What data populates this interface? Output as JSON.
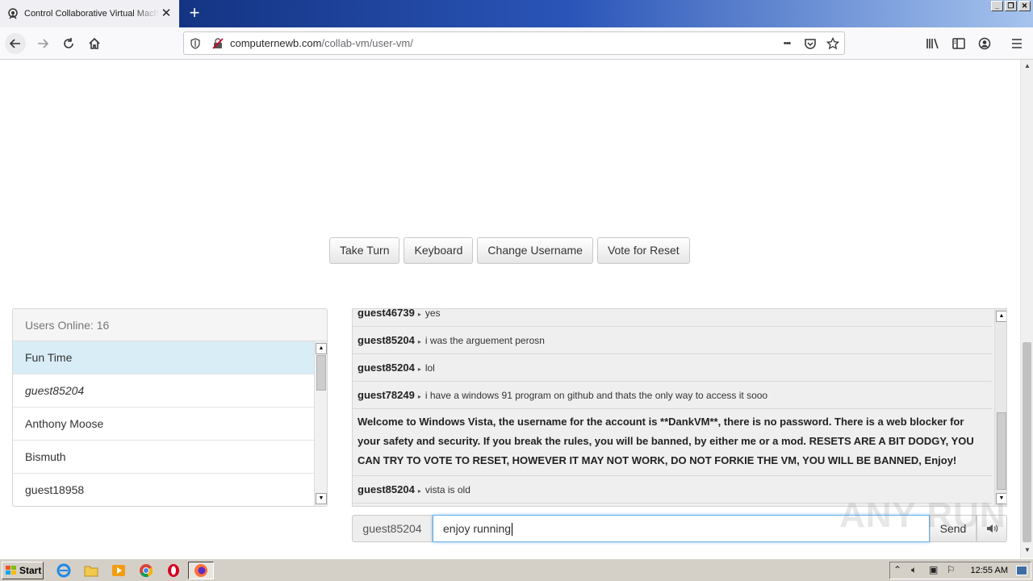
{
  "browser": {
    "tab_title": "Control Collaborative Virtual Machines",
    "url_domain": "computernewb.com",
    "url_path": "/collab-vm/user-vm/",
    "url_more": "•••"
  },
  "actions": [
    "Take Turn",
    "Keyboard",
    "Change Username",
    "Vote for Reset"
  ],
  "users": {
    "header": "Users Online: 16",
    "list": [
      {
        "name": "Fun Time"
      },
      {
        "name": "guest85204"
      },
      {
        "name": "Anthony Moose"
      },
      {
        "name": "Bismuth"
      },
      {
        "name": "guest18958"
      }
    ]
  },
  "chat": {
    "messages": [
      {
        "user": "guest46739",
        "text": "yes"
      },
      {
        "user": "guest85204",
        "text": "i was the arguement perosn"
      },
      {
        "user": "guest85204",
        "text": "lol"
      },
      {
        "user": "guest78249",
        "text": "i have a windows 91 program on github and thats the only way to access it sooo"
      },
      {
        "notice": "Welcome to Windows Vista, the username for the account is **DankVM**, there is no password. There is a web blocker for your safety and security. If you break the rules, you will be banned, by either me or a mod. RESETS ARE A BIT DODGY, YOU CAN TRY TO VOTE TO RESET, HOWEVER IT MAY NOT WORK, DO NOT FORKIE THE VM, YOU WILL BE BANNED, Enjoy!"
      },
      {
        "user": "guest85204",
        "text": "vista is old"
      }
    ],
    "input_username": "guest85204",
    "input_value": "enjoy running",
    "send_label": "Send"
  },
  "watermark": "ANY RUN",
  "taskbar": {
    "start_label": "Start",
    "clock": "12:55 AM"
  }
}
